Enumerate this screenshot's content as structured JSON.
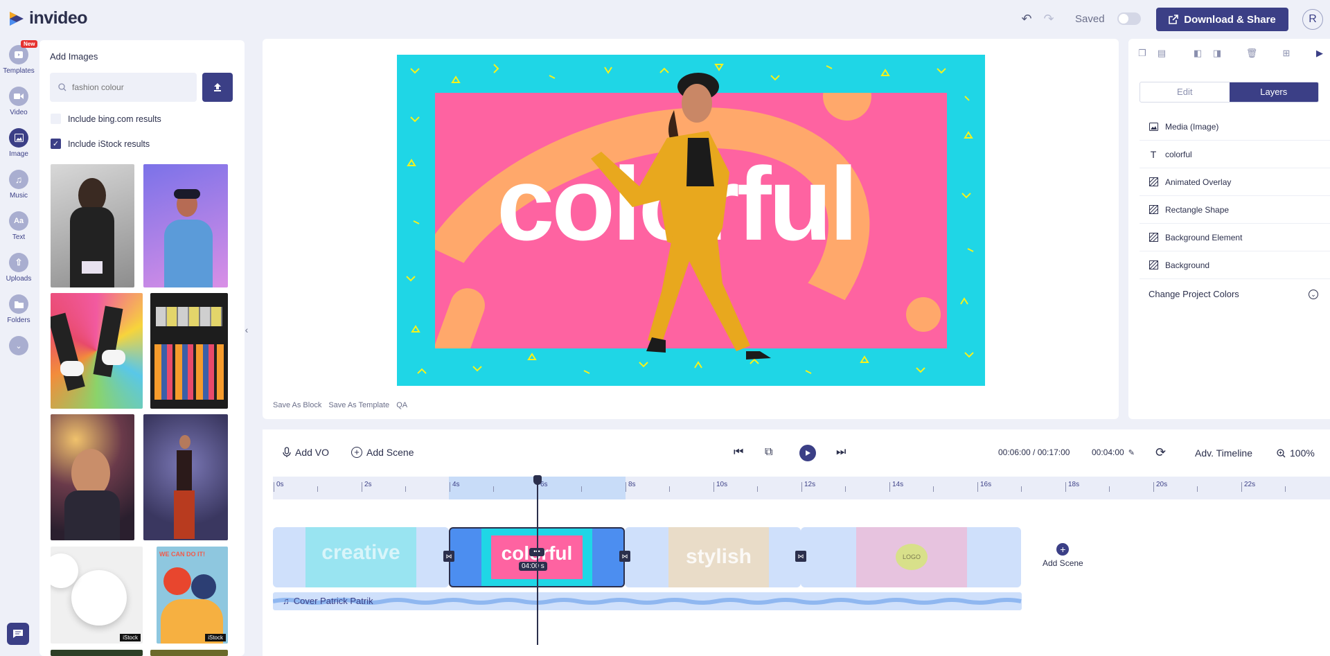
{
  "header": {
    "logo_text": "invideo",
    "saved_label": "Saved",
    "download_label": "Download & Share",
    "avatar_letter": "R"
  },
  "rail": {
    "items": [
      {
        "label": "Templates",
        "icon": "templates-icon",
        "badge": "New"
      },
      {
        "label": "Video",
        "icon": "video-icon"
      },
      {
        "label": "Image",
        "icon": "image-icon"
      },
      {
        "label": "Music",
        "icon": "music-icon"
      },
      {
        "label": "Text",
        "icon": "text-icon"
      },
      {
        "label": "Uploads",
        "icon": "upload-icon"
      },
      {
        "label": "Folders",
        "icon": "folder-icon"
      }
    ]
  },
  "image_panel": {
    "title": "Add Images",
    "search_placeholder": "fashion colour",
    "include_bing": "Include bing.com results",
    "include_istock": "Include iStock results",
    "istock_badge": "iStock",
    "poster_text": "WE CAN DO IT!"
  },
  "canvas": {
    "headline": "colorful",
    "actions": [
      "Save As Block",
      "Save As Template",
      "QA"
    ]
  },
  "right_panel": {
    "tabs": [
      "Edit",
      "Layers"
    ],
    "active_tab": "Layers",
    "layers": [
      {
        "label": "Media (Image)",
        "icon": "image-icon"
      },
      {
        "label": "colorful",
        "icon": "text-icon"
      },
      {
        "label": "Animated Overlay",
        "icon": "layer-icon"
      },
      {
        "label": "Rectangle Shape",
        "icon": "layer-icon"
      },
      {
        "label": "Background Element",
        "icon": "layer-icon"
      },
      {
        "label": "Background",
        "icon": "layer-icon"
      }
    ],
    "change_colors": "Change Project Colors"
  },
  "timeline": {
    "add_vo": "Add VO",
    "add_scene": "Add Scene",
    "time_current": "00:06:00 / 00:17:00",
    "duration": "00:04:00",
    "adv_timeline": "Adv. Timeline",
    "zoom": "100%",
    "ticks": [
      "0s",
      "2s",
      "4s",
      "6s",
      "8s",
      "10s",
      "12s",
      "14s",
      "16s",
      "18s",
      "20s",
      "22s"
    ],
    "scenes": [
      {
        "label": "creative"
      },
      {
        "label": "colorful",
        "duration": "04:00 s"
      },
      {
        "label": "stylish"
      },
      {
        "label": "LOGO"
      }
    ],
    "audio_label": "Cover Patrick Patrik",
    "add_scene_end": "Add Scene"
  }
}
